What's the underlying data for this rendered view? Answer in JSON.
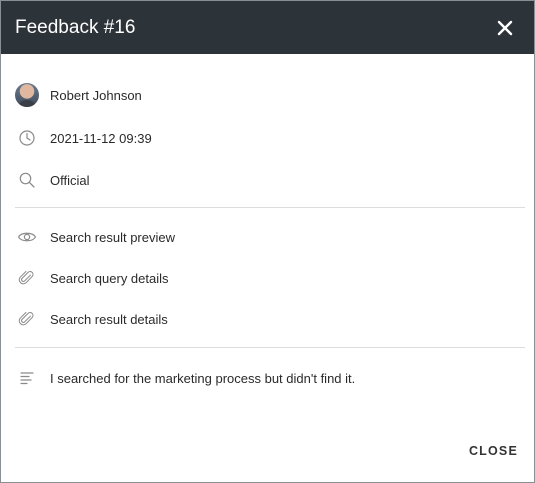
{
  "dialog": {
    "title": "Feedback #16",
    "close_label": "CLOSE"
  },
  "details": {
    "user": "Robert Johnson",
    "timestamp": "2021-11-12 09:39",
    "source": "Official"
  },
  "links": [
    {
      "label": "Search result preview",
      "icon": "eye-icon"
    },
    {
      "label": "Search query details",
      "icon": "paperclip-icon"
    },
    {
      "label": "Search result details",
      "icon": "paperclip-icon"
    }
  ],
  "comment": {
    "text": "I searched for the marketing process but didn't find it.",
    "icon": "notes-icon"
  },
  "colors": {
    "header_bg": "#2c3339",
    "header_text": "#ffffff"
  }
}
